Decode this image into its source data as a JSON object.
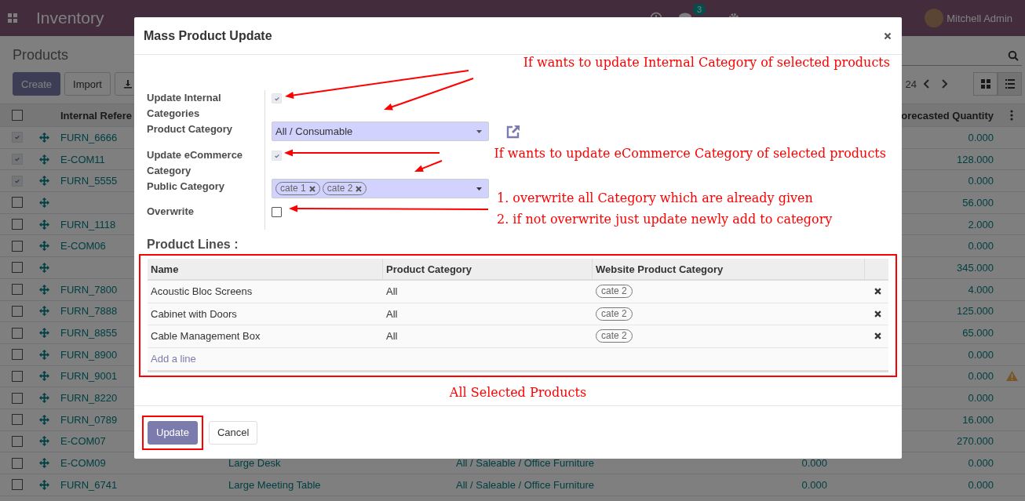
{
  "navbar": {
    "app_title": "Inventory",
    "chat_count": "3",
    "user": "Mitchell Admin"
  },
  "control_panel": {
    "title": "Products",
    "buttons": [
      "Create",
      "Import"
    ],
    "pager": "24"
  },
  "list": {
    "header_checked": false,
    "columns": [
      "Internal Refere",
      "orecasted Quantity"
    ],
    "rows": [
      {
        "checked": true,
        "ref": "FURN_6666",
        "forecast": "0.000",
        "warning": false
      },
      {
        "checked": true,
        "ref": "E-COM11",
        "forecast": "128.000",
        "warning": false
      },
      {
        "checked": true,
        "ref": "FURN_5555",
        "forecast": "0.000",
        "warning": false
      },
      {
        "checked": false,
        "ref": "",
        "forecast": "56.000",
        "warning": false
      },
      {
        "checked": false,
        "ref": "FURN_1118",
        "forecast": "2.000",
        "warning": false
      },
      {
        "checked": false,
        "ref": "E-COM06",
        "forecast": "0.000",
        "warning": false
      },
      {
        "checked": false,
        "ref": "",
        "forecast": "345.000",
        "warning": false
      },
      {
        "checked": false,
        "ref": "FURN_7800",
        "forecast": "4.000",
        "warning": false
      },
      {
        "checked": false,
        "ref": "FURN_7888",
        "forecast": "125.000",
        "warning": false
      },
      {
        "checked": false,
        "ref": "FURN_8855",
        "forecast": "65.000",
        "warning": false
      },
      {
        "checked": false,
        "ref": "FURN_8900",
        "forecast": "0.000",
        "warning": false
      },
      {
        "checked": false,
        "ref": "FURN_9001",
        "forecast": "0.000",
        "warning": true
      },
      {
        "checked": false,
        "ref": "FURN_8220",
        "forecast": "0.000",
        "warning": false
      },
      {
        "checked": false,
        "ref": "FURN_0789",
        "forecast": "16.000",
        "warning": false
      },
      {
        "checked": false,
        "ref": "E-COM07",
        "forecast": "270.000",
        "warning": false
      },
      {
        "checked": false,
        "ref": "E-COM09",
        "name": "Large Desk",
        "category": "All / Saleable / Office Furniture",
        "quantity": "0.000",
        "forecast": "0.000",
        "warning": false
      },
      {
        "checked": false,
        "ref": "FURN_6741",
        "name": "Large Meeting Table",
        "category": "All / Saleable / Office Furniture",
        "quantity": "0.000",
        "forecast": "0.000",
        "warning": false
      }
    ]
  },
  "modal": {
    "title": "Mass Product Update",
    "fields": [
      {
        "kind": "checkbox",
        "label": "Update Internal Categories",
        "checked": true
      },
      {
        "kind": "select",
        "label": "Product Category",
        "value": "All / Consumable"
      },
      {
        "kind": "checkbox",
        "label": "Update eCommerce Category",
        "checked": true
      },
      {
        "kind": "tags",
        "label": "Public Category",
        "tags": [
          "cate 1",
          "cate 2"
        ]
      },
      {
        "kind": "checkbox",
        "label": "Overwrite",
        "checked": false
      }
    ],
    "lines": {
      "title": "Product Lines :",
      "columns": [
        "Name",
        "Product Category",
        "Website Product Category"
      ],
      "rows": [
        {
          "name": "Acoustic Bloc Screens",
          "category": "All",
          "tags": [
            "cate 2"
          ]
        },
        {
          "name": "Cabinet with Doors",
          "category": "All",
          "tags": [
            "cate 2"
          ]
        },
        {
          "name": "Cable Management Box",
          "category": "All",
          "tags": [
            "cate 2"
          ]
        }
      ],
      "add_label": "Add a line"
    },
    "buttons": [
      {
        "label": "Update",
        "kind": "primary"
      },
      {
        "label": "Cancel",
        "kind": "secondary"
      }
    ]
  },
  "annotations": [
    "If wants to update Internal Category of selected products",
    "If wants to update eCommerce Category of selected products",
    "1. overwrite all Category which are already given",
    "2. if not overwrite just update newly add to category",
    "All Selected Products"
  ]
}
